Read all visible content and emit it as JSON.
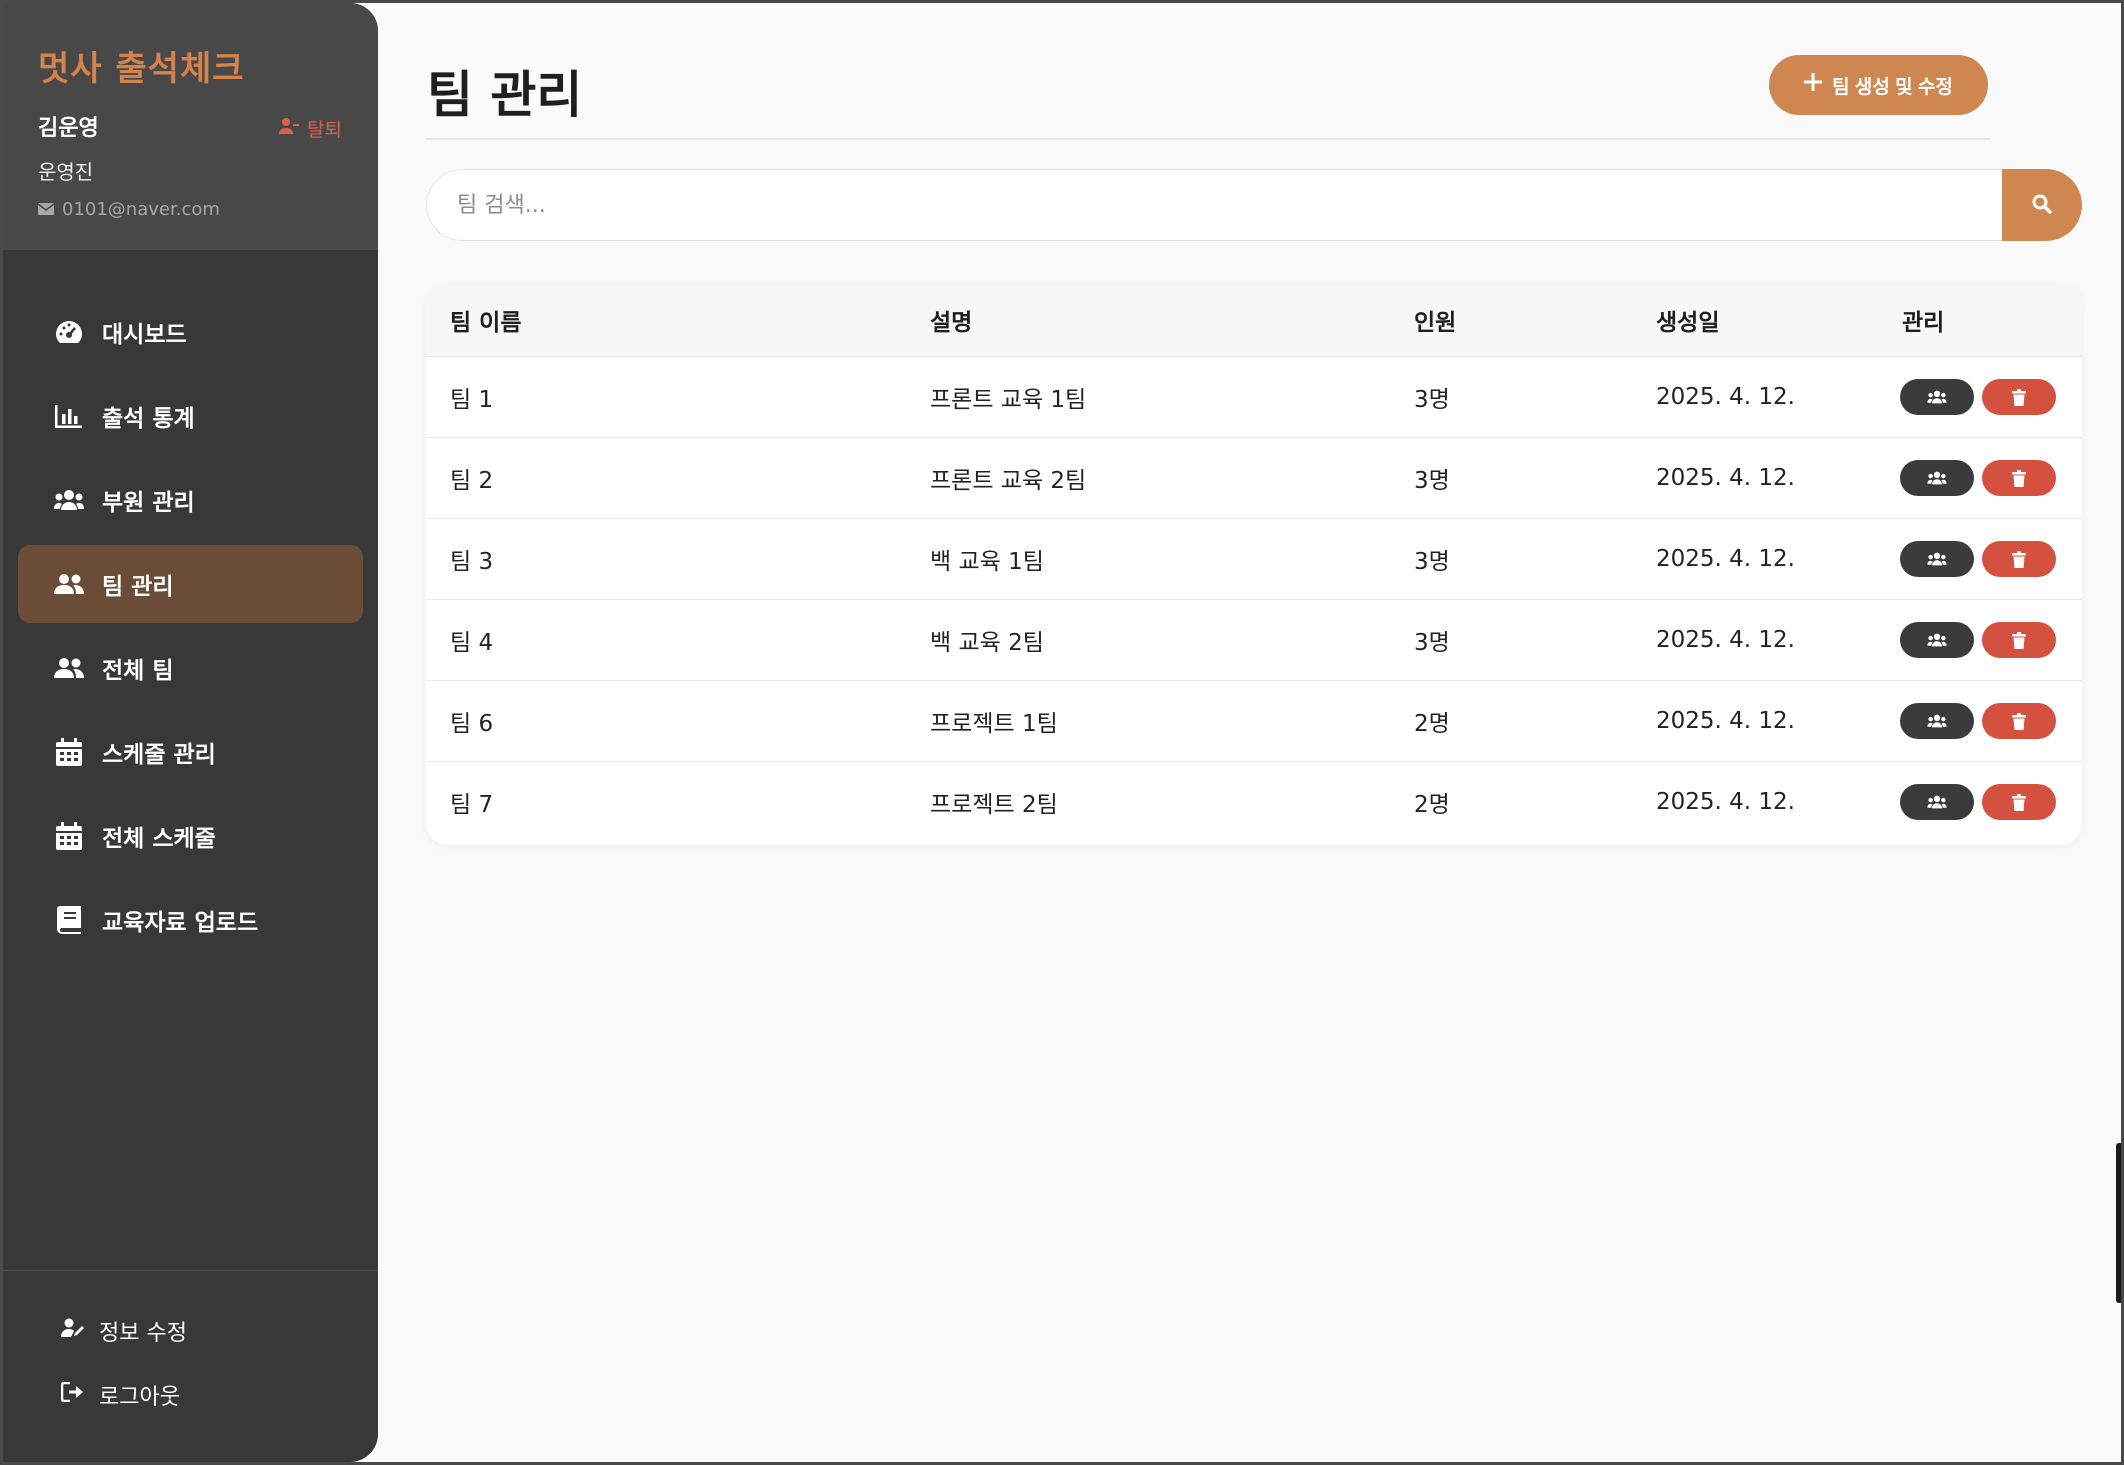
{
  "app": {
    "brand": "멋사 출석체크"
  },
  "profile": {
    "name": "김운영",
    "role": "운영진",
    "email": "0101@naver.com",
    "leave_label": "탈퇴"
  },
  "nav": {
    "items": [
      {
        "label": "대시보드",
        "icon": "dashboard-icon"
      },
      {
        "label": "출석 통계",
        "icon": "chart-bar-icon"
      },
      {
        "label": "부원 관리",
        "icon": "users-icon"
      },
      {
        "label": "팀 관리",
        "icon": "team-icon",
        "active": true
      },
      {
        "label": "전체 팀",
        "icon": "team-icon"
      },
      {
        "label": "스케줄 관리",
        "icon": "calendar-icon"
      },
      {
        "label": "전체 스케줄",
        "icon": "calendar-icon"
      },
      {
        "label": "교육자료 업로드",
        "icon": "book-icon"
      }
    ]
  },
  "footer": {
    "edit_profile": "정보 수정",
    "logout": "로그아웃"
  },
  "main": {
    "title": "팀 관리",
    "create_button": "팀 생성 및 수정",
    "search_placeholder": "팀 검색..."
  },
  "table": {
    "headers": [
      "팀 이름",
      "설명",
      "인원",
      "생성일",
      "관리"
    ],
    "rows": [
      {
        "name": "팀 1",
        "desc": "프론트 교육 1팀",
        "members": "3명",
        "created": "2025. 4. 12."
      },
      {
        "name": "팀 2",
        "desc": "프론트 교육 2팀",
        "members": "3명",
        "created": "2025. 4. 12."
      },
      {
        "name": "팀 3",
        "desc": "백 교육 1팀",
        "members": "3명",
        "created": "2025. 4. 12."
      },
      {
        "name": "팀 4",
        "desc": "백 교육 2팀",
        "members": "3명",
        "created": "2025. 4. 12."
      },
      {
        "name": "팀 6",
        "desc": "프로젝트 1팀",
        "members": "2명",
        "created": "2025. 4. 12."
      },
      {
        "name": "팀 7",
        "desc": "프로젝트 2팀",
        "members": "2명",
        "created": "2025. 4. 12."
      }
    ]
  },
  "colors": {
    "accent": "#cf8752",
    "sidebar_bg": "#383838",
    "active_nav": "#6b4c36",
    "danger": "#d4513f"
  }
}
